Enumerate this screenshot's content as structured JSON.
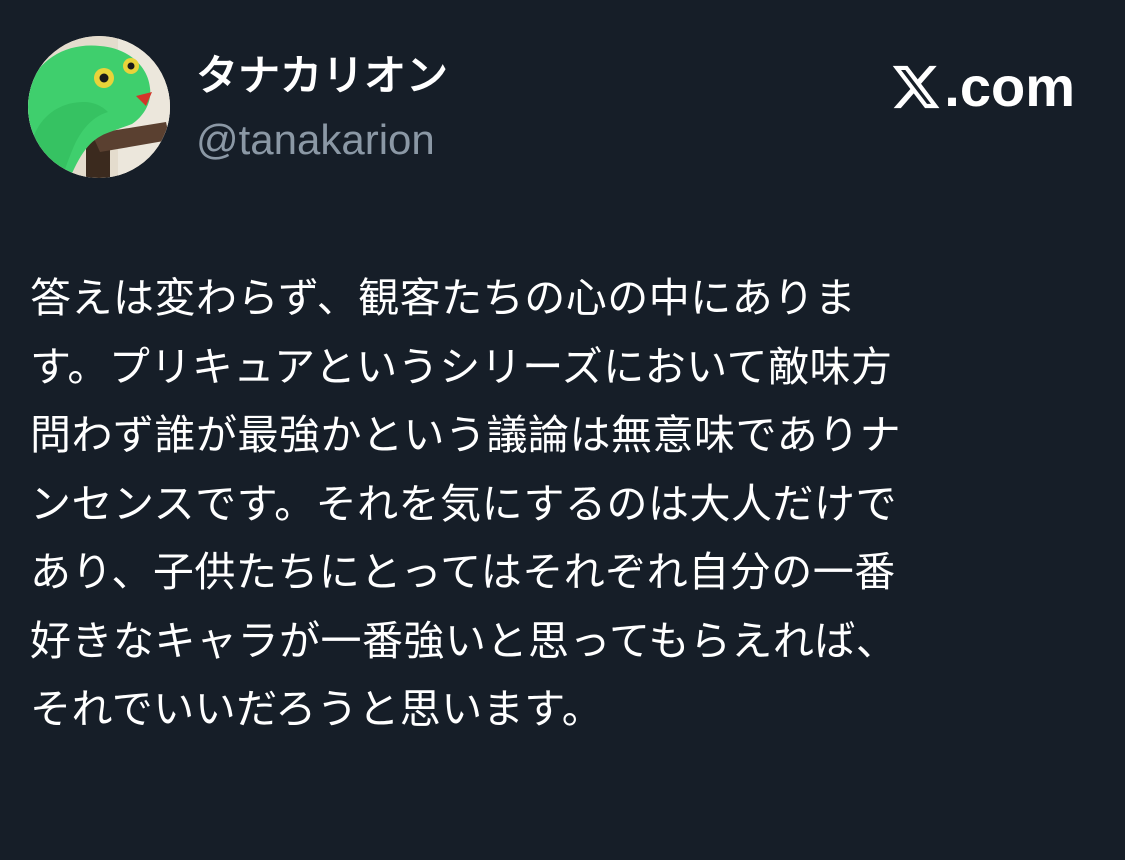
{
  "author": {
    "display_name": "タナカリオン",
    "handle": "@tanakarion",
    "avatar_icon": "green-puppet-avatar"
  },
  "brand": {
    "text": ".com",
    "logo_icon": "x-logo-icon"
  },
  "tweet": {
    "lines": [
      "答えは変わらず、観客たちの心の中にありま",
      "す。プリキュアというシリーズにおいて敵味方",
      "問わず誰が最強かという議論は無意味でありナ",
      "ンセンスです。それを気にするのは大人だけで",
      "あり、子供たちにとってはそれぞれ自分の一番",
      "好きなキャラが一番強いと思ってもらえれば、",
      "それでいいだろうと思います。"
    ]
  },
  "colors": {
    "background": "#161e28",
    "text": "#ffffff",
    "muted": "#8b98a5"
  }
}
